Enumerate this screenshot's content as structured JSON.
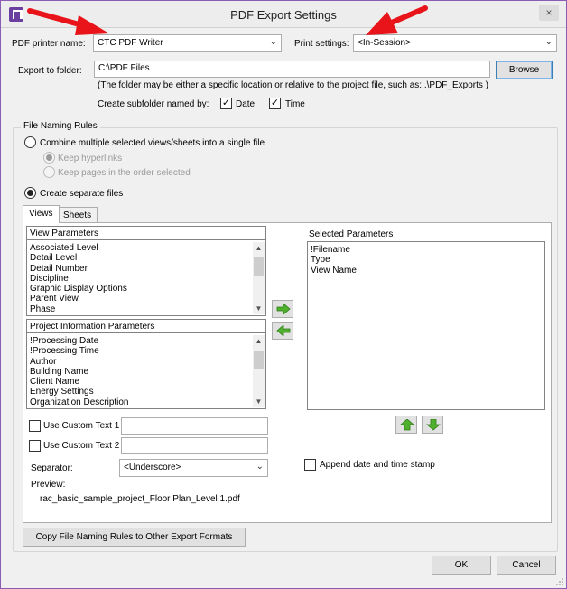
{
  "window": {
    "title": "PDF Export Settings",
    "close_glyph": "×"
  },
  "icons": {
    "app": "revit-logo-icon",
    "close": "close-icon"
  },
  "colors": {
    "accent": "#6b3fa0",
    "annotation_arrow": "#e8141a",
    "arrow_green": "#4fb02d"
  },
  "printer": {
    "label": "PDF printer name:",
    "value": "CTC PDF Writer",
    "print_settings_label": "Print settings:",
    "print_settings_value": "<In-Session>"
  },
  "export": {
    "label": "Export to folder:",
    "value": "C:\\PDF Files",
    "browse_label": "Browse",
    "hint": "(The folder may be either a specific location or relative to the project file, such as:  .\\PDF_Exports )",
    "subfolder_label": "Create subfolder named by:",
    "date_label": "Date",
    "date_checked": true,
    "time_label": "Time",
    "time_checked": true
  },
  "naming": {
    "group_label": "File Naming Rules",
    "combine_label": "Combine multiple selected views/sheets into a single file",
    "keep_hyperlinks_label": "Keep hyperlinks",
    "keep_order_label": "Keep pages in the order selected",
    "separate_label": "Create separate files",
    "tabs": [
      {
        "label": "Views"
      },
      {
        "label": "Sheets"
      }
    ],
    "view_params": {
      "header": "View Parameters",
      "items": [
        "Associated Level",
        "Detail Level",
        "Detail Number",
        "Discipline",
        "Graphic Display Options",
        "Parent View",
        "Phase"
      ]
    },
    "project_params": {
      "header": "Project Information Parameters",
      "items": [
        "!Processing Date",
        "!Processing Time",
        "Author",
        "Building Name",
        "Client Name",
        "Energy Settings",
        "Organization Description"
      ]
    },
    "selected_params": {
      "header": "Selected Parameters",
      "items": [
        "!Filename",
        "Type",
        "View Name"
      ]
    },
    "custom_text_1_label": "Use Custom Text 1",
    "custom_text_1_value": "",
    "custom_text_2_label": "Use Custom Text 2",
    "custom_text_2_value": "",
    "separator_label": "Separator:",
    "separator_value": "<Underscore>",
    "append_label": "Append date and time stamp",
    "preview_label": "Preview:",
    "preview_value": "rac_basic_sample_project_Floor Plan_Level 1.pdf"
  },
  "footer": {
    "copy_button": "Copy File Naming Rules to Other Export Formats",
    "ok_label": "OK",
    "cancel_label": "Cancel"
  },
  "glyphs": {
    "dropdown": "⌄",
    "scroll_up": "▲",
    "scroll_down": "▼",
    "check": "✓"
  }
}
